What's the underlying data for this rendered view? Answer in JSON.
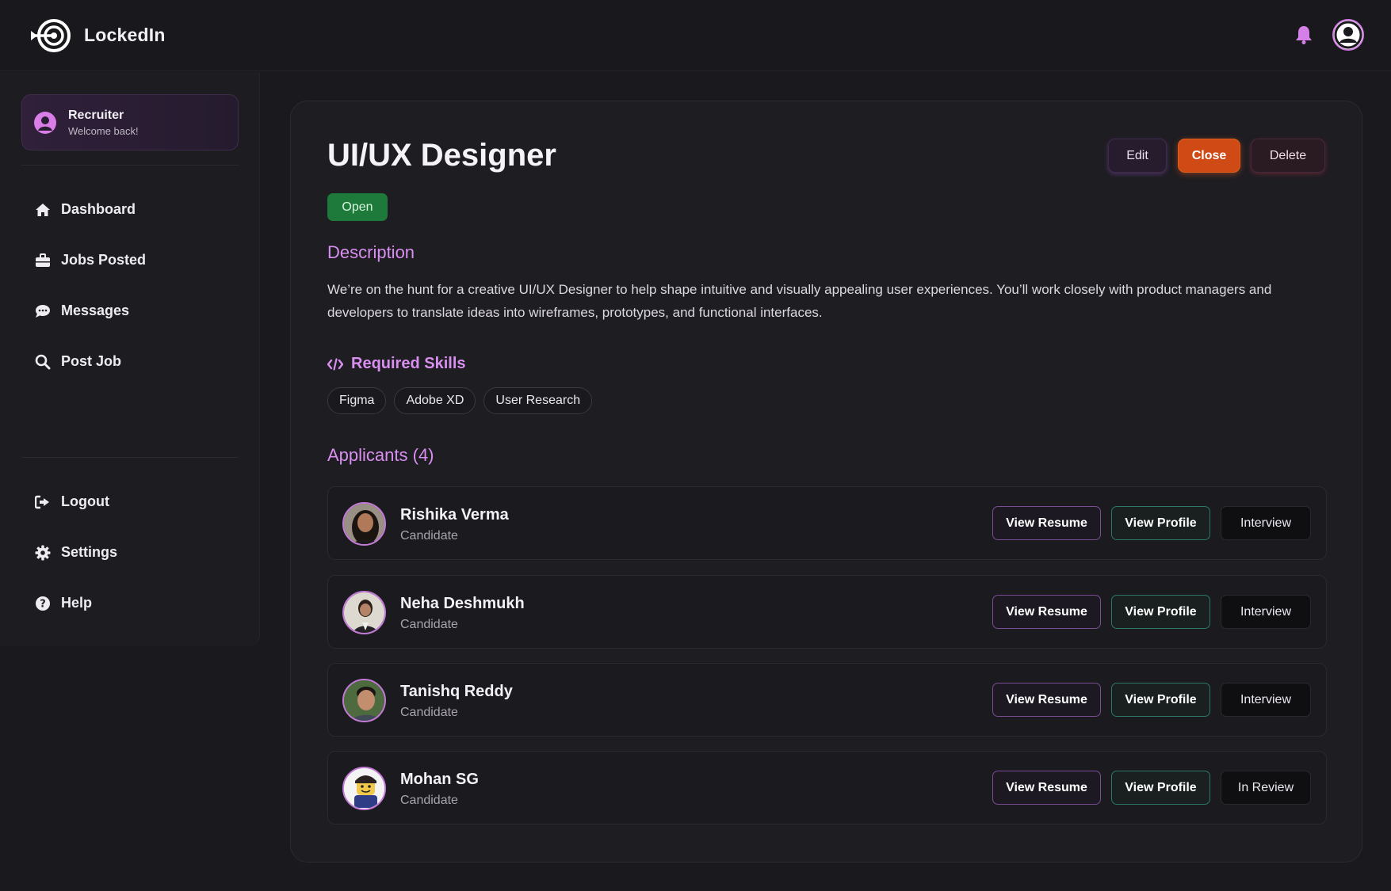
{
  "app": {
    "name": "LockedIn"
  },
  "header": {
    "bell_icon": "bell-icon",
    "avatar_icon": "user-circle-icon",
    "accent": "#d580e8"
  },
  "sidebar": {
    "role_title": "Recruiter",
    "role_subtitle": "Welcome back!",
    "nav": [
      {
        "label": "Dashboard",
        "icon": "home-icon"
      },
      {
        "label": "Jobs Posted",
        "icon": "briefcase-icon"
      },
      {
        "label": "Messages",
        "icon": "chat-icon"
      },
      {
        "label": "Post Job",
        "icon": "search-icon"
      }
    ],
    "bottom": [
      {
        "label": "Logout",
        "icon": "logout-icon"
      },
      {
        "label": "Settings",
        "icon": "gear-icon"
      },
      {
        "label": "Help",
        "icon": "help-icon"
      }
    ]
  },
  "job": {
    "title": "UI/UX Designer",
    "status": "Open",
    "actions": {
      "edit": "Edit",
      "close": "Close",
      "delete": "Delete"
    },
    "description_heading": "Description",
    "description": "We’re on the hunt for a creative UI/UX Designer to help shape intuitive and visually appealing user experiences. You’ll work closely with product managers and developers to translate ideas into wireframes, prototypes, and functional interfaces.",
    "skills_heading": "Required Skills",
    "skills": [
      "Figma",
      "Adobe XD",
      "User Research"
    ],
    "applicants_heading": "Applicants (4)",
    "applicants": [
      {
        "name": "Rishika Verma",
        "role": "Candidate",
        "resume": "View Resume",
        "profile": "View Profile",
        "status": "Interview"
      },
      {
        "name": "Neha Deshmukh",
        "role": "Candidate",
        "resume": "View Resume",
        "profile": "View Profile",
        "status": "Interview"
      },
      {
        "name": "Tanishq Reddy",
        "role": "Candidate",
        "resume": "View Resume",
        "profile": "View Profile",
        "status": "Interview"
      },
      {
        "name": "Mohan SG",
        "role": "Candidate",
        "resume": "View Resume",
        "profile": "View Profile",
        "status": "In Review"
      }
    ]
  },
  "colors": {
    "open_badge": "#1d7a3a",
    "close_button": "#cf4a15",
    "heading_accent": "#d98ff0"
  }
}
